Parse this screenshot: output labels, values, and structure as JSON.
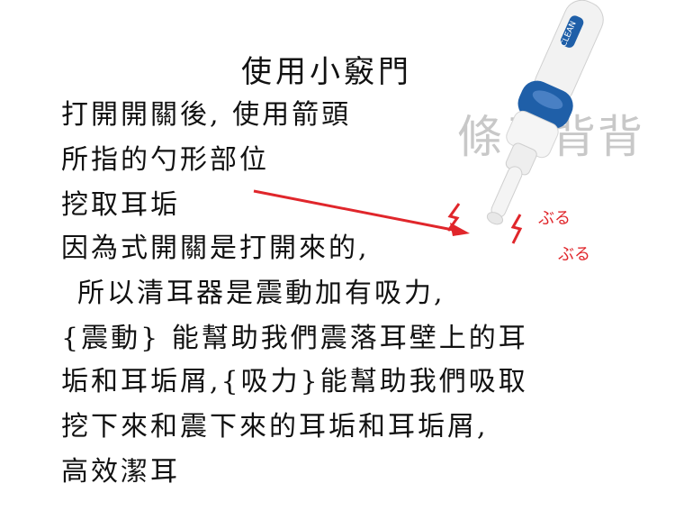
{
  "title": "使用小竅門",
  "lines": [
    "打開開關後, 使用箭頭",
    "所指的勺形部位",
    "挖取耳垢",
    "因為式開關是打開來的,",
    "所以清耳器是震動加有吸力,",
    "{震動} 能幫助我們震落耳壁上的耳",
    "垢和耳垢屑,{吸力}能幫助我們吸取",
    "挖下來和震下來的耳垢和耳垢屑,",
    "高效潔耳"
  ],
  "watermark": "條子背背",
  "device": {
    "brand": "CLEAN",
    "vibration_text_1": "ぶる",
    "vibration_text_2": "ぶる",
    "accent_color": "#1f5fa8",
    "arrow_color": "#e0262b",
    "spark_color": "#e0262b"
  }
}
